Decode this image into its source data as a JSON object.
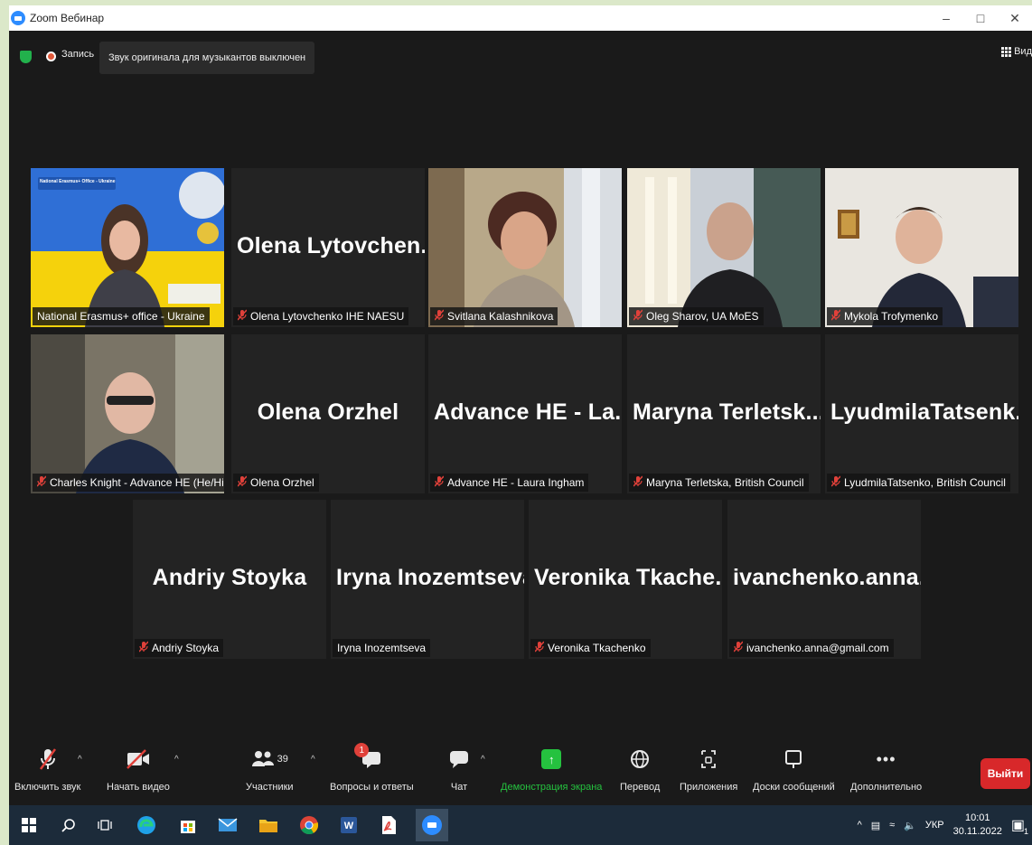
{
  "window": {
    "title": "Zoom Вебинар"
  },
  "topbar": {
    "record_label": "Запись",
    "original_sound": "Звук оригинала для музыкантов выключен",
    "view_label": "Вид"
  },
  "participants": [
    {
      "big": "",
      "label": "National Erasmus+ office - Ukraine",
      "muted": false,
      "video": "erasmus",
      "active": true
    },
    {
      "big": "Olena  Lytovchen...",
      "label": "Olena Lytovchenko IHE NAESU",
      "muted": true
    },
    {
      "big": "",
      "label": "Svitlana Kalashnikova",
      "muted": true,
      "video": "svitlana"
    },
    {
      "big": "",
      "label": "Oleg Sharov, UA MoES",
      "muted": true,
      "video": "oleg"
    },
    {
      "big": "",
      "label": "Mykola Trofymenko",
      "muted": true,
      "video": "mykola"
    },
    {
      "big": "",
      "label": "Charles Knight - Advance HE (He/Him)",
      "muted": true,
      "video": "charles"
    },
    {
      "big": "Olena Orzhel",
      "label": "Olena Orzhel",
      "muted": true
    },
    {
      "big": "Advance HE - La...",
      "label": "Advance HE - Laura Ingham",
      "muted": true
    },
    {
      "big": "Maryna  Terletsk...",
      "label": "Maryna Terletska, British Council",
      "muted": true
    },
    {
      "big": "LyudmilaTatsenk...",
      "label": "LyudmilaTatsenko, British Council",
      "muted": true
    },
    {
      "big": "Andriy Stoyka",
      "label": "Andriy Stoyka",
      "muted": true
    },
    {
      "big": "Iryna Inozemtseva",
      "label": "Iryna Inozemtseva",
      "muted": false
    },
    {
      "big": "Veronika  Tkache...",
      "label": "Veronika Tkachenko",
      "muted": true
    },
    {
      "big": "ivanchenko.anna...",
      "label": "ivanchenko.anna@gmail.com",
      "muted": true
    }
  ],
  "erasmus_banner": "National Erasmus+ Office - Ukraine",
  "toolbar": {
    "unmute": "Включить звук",
    "start_video": "Начать видео",
    "participants": "Участники",
    "participants_count": "39",
    "qa": "Вопросы и ответы",
    "qa_badge": "1",
    "chat": "Чат",
    "share": "Демонстрация экрана",
    "translate": "Перевод",
    "apps": "Приложения",
    "whiteboards": "Доски сообщений",
    "more": "Дополнительно",
    "leave": "Выйти"
  },
  "taskbar": {
    "lang": "УКР",
    "time": "10:01",
    "date": "30.11.2022",
    "notif_count": "1"
  },
  "colors": {
    "accent_green": "#25c23f",
    "leave_red": "#d8282a",
    "active_speaker": "#f5e94a",
    "muted_red": "#e0413a"
  }
}
